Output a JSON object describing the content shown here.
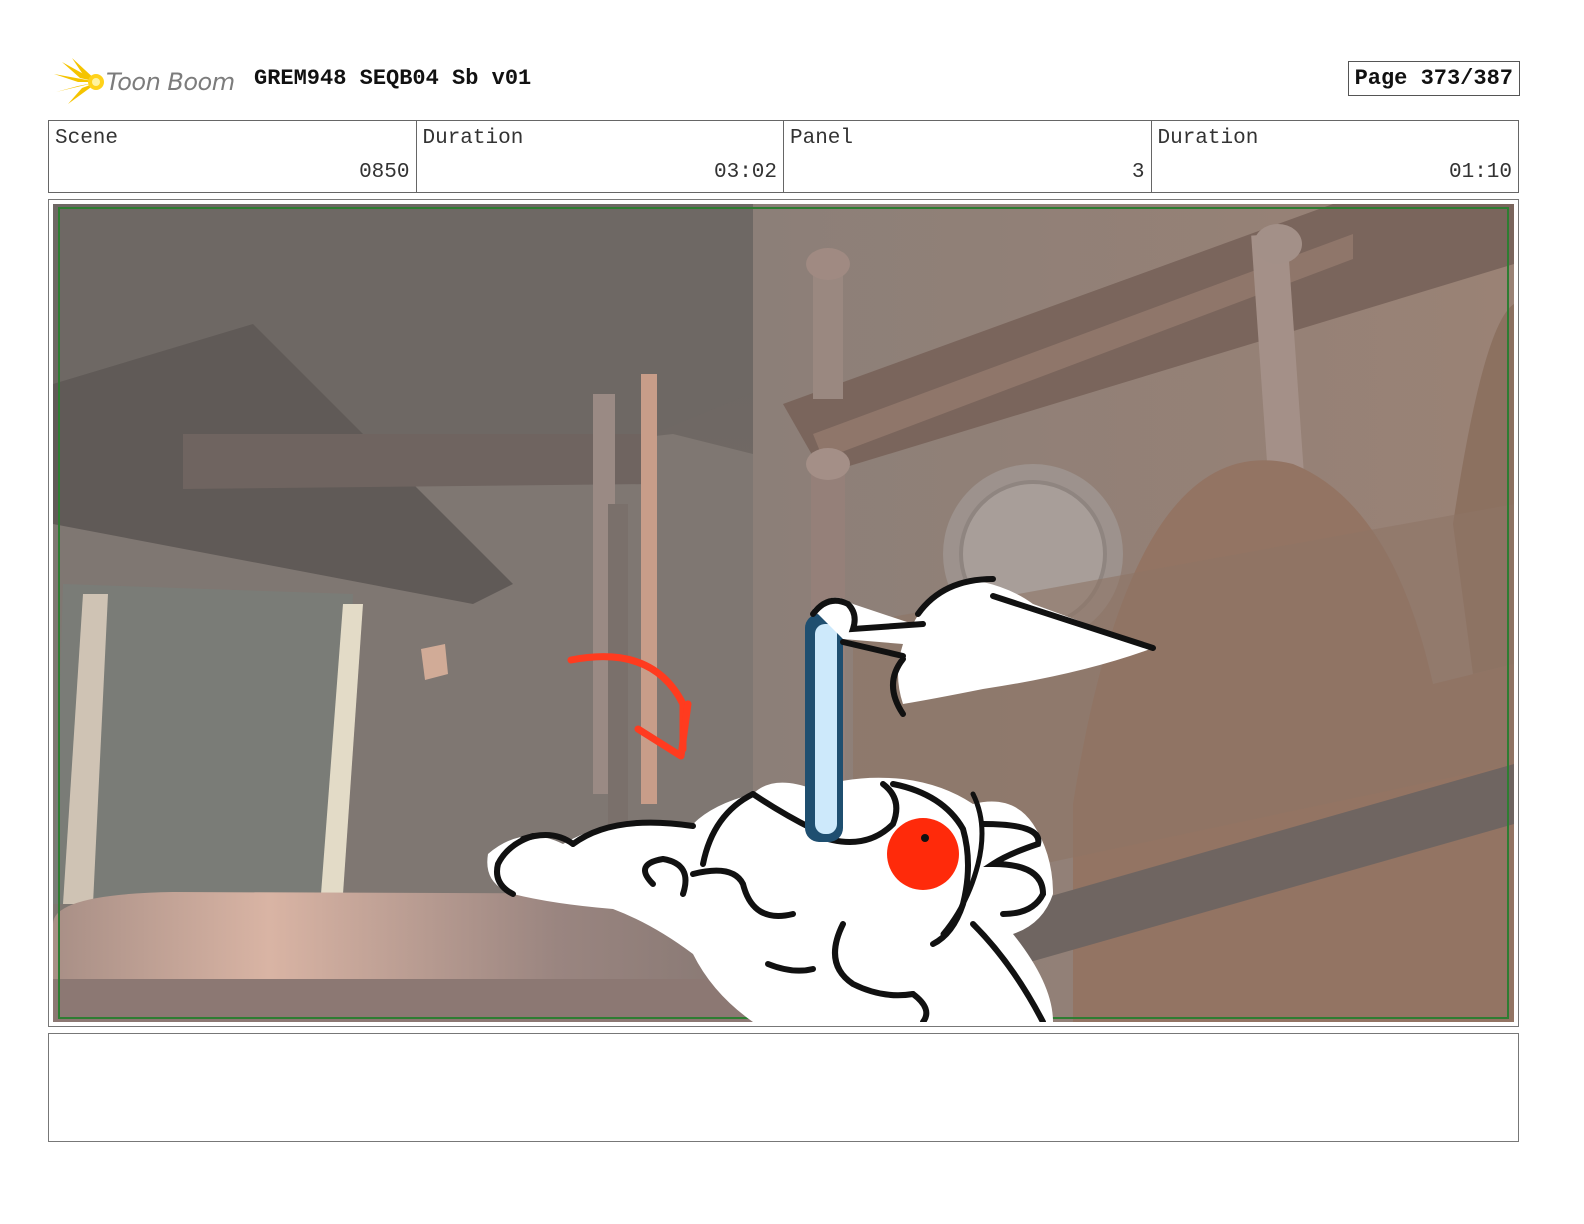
{
  "header": {
    "logo_text": "Toon Boom",
    "doc_title": "GREM948 SEQB04 Sb v01",
    "page_label": "Page 373/387"
  },
  "info": {
    "scene_label": "Scene",
    "scene_value": "0850",
    "duration_label": "Duration",
    "duration_value": "03:02",
    "panel_label": "Panel",
    "panel_value": "3",
    "panel_duration_label": "Duration",
    "panel_duration_value": "01:10"
  },
  "panel": {
    "image_description_icon": "storyboard-drawing",
    "safe_frame_color": "#2e7d32",
    "action_arrow_color": "#ff3b1f"
  },
  "notes": {
    "text": ""
  }
}
